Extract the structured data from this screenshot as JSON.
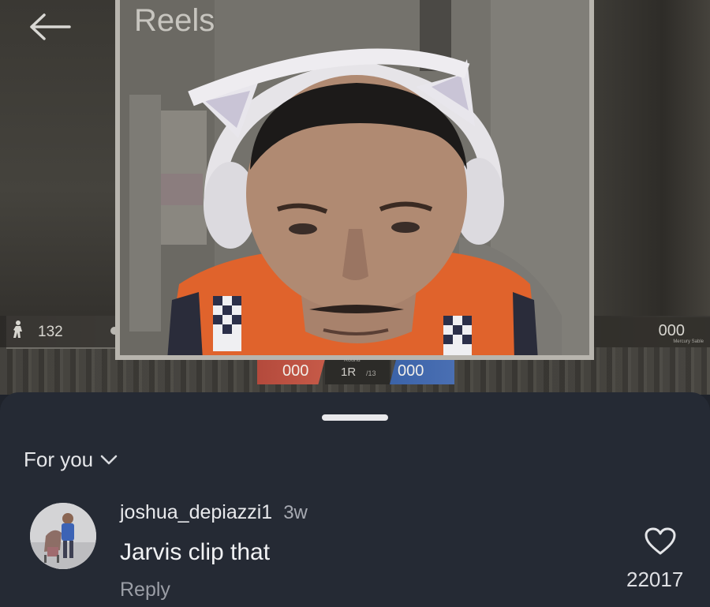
{
  "header": {
    "title": "Reels",
    "back_icon": "arrow-left-icon"
  },
  "video": {
    "hud_left_count": "132",
    "hud_right_value": "000",
    "hud_right_sub": "Mercury Sable",
    "score_red": "000",
    "score_blue": "000",
    "round_label": "1R",
    "round_sub": "/13",
    "round_top": "Round"
  },
  "sheet": {
    "filter_label": "For you",
    "filter_icon": "chevron-down-icon"
  },
  "comments": [
    {
      "username": "joshua_depiazzi1",
      "time": "3w",
      "text": "Jarvis clip that",
      "reply_label": "Reply",
      "like_count": "22017",
      "like_icon": "heart-outline-icon"
    }
  ],
  "colors": {
    "sheet_bg": "#252a34",
    "score_red": "#c65a48",
    "score_blue": "#4a6fb3",
    "vest_orange": "#e0632c"
  }
}
